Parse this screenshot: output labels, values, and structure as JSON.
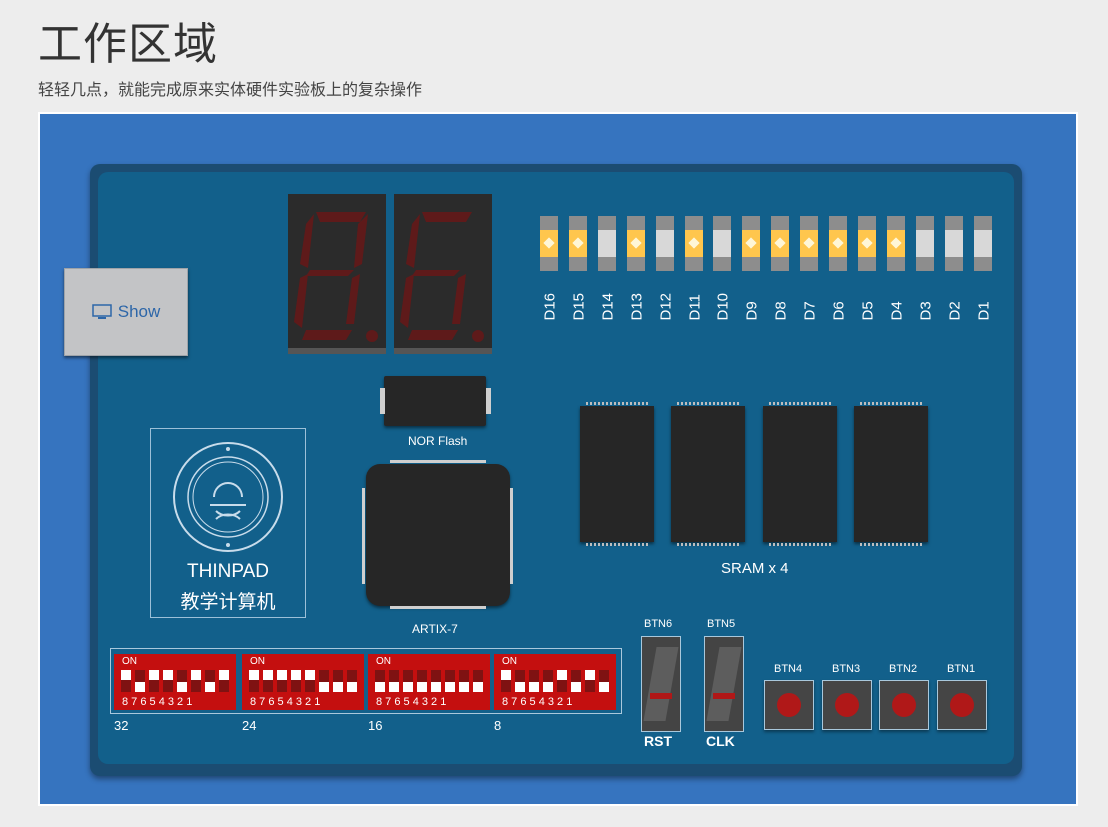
{
  "page": {
    "title": "工作区域",
    "subtitle": "轻轻几点，就能完成原来实体硬件实验板上的复杂操作"
  },
  "show_button": {
    "label": "Show",
    "icon": "monitor-icon"
  },
  "leds": [
    {
      "label": "D16",
      "on": true
    },
    {
      "label": "D15",
      "on": true
    },
    {
      "label": "D14",
      "on": false
    },
    {
      "label": "D13",
      "on": true
    },
    {
      "label": "D12",
      "on": false
    },
    {
      "label": "D11",
      "on": true
    },
    {
      "label": "D10",
      "on": false
    },
    {
      "label": "D9",
      "on": true
    },
    {
      "label": "D8",
      "on": true
    },
    {
      "label": "D7",
      "on": true
    },
    {
      "label": "D6",
      "on": true
    },
    {
      "label": "D5",
      "on": true
    },
    {
      "label": "D4",
      "on": true
    },
    {
      "label": "D3",
      "on": false
    },
    {
      "label": "D2",
      "on": false
    },
    {
      "label": "D1",
      "on": false
    }
  ],
  "chips": {
    "flash": "NOR Flash",
    "fpga": "ARTIX-7",
    "sram": "SRAM x 4"
  },
  "logo": {
    "name": "THINPAD",
    "subtitle": "教学计算机"
  },
  "dip_switches": [
    {
      "group": "32",
      "on_label": "ON",
      "numbers": "8 7 6 5 4 3 2 1",
      "states": [
        "up",
        "dn",
        "up",
        "up",
        "dn",
        "up",
        "dn",
        "up"
      ]
    },
    {
      "group": "24",
      "on_label": "ON",
      "numbers": "8 7 6 5 4 3 2 1",
      "states": [
        "up",
        "up",
        "up",
        "up",
        "up",
        "dn",
        "dn",
        "dn"
      ]
    },
    {
      "group": "16",
      "on_label": "ON",
      "numbers": "8 7 6 5 4 3 2 1",
      "states": [
        "dn",
        "dn",
        "dn",
        "dn",
        "dn",
        "dn",
        "dn",
        "dn"
      ]
    },
    {
      "group": "8",
      "on_label": "ON",
      "numbers": "8 7 6 5 4 3 2 1",
      "states": [
        "up",
        "dn",
        "dn",
        "dn",
        "up",
        "dn",
        "up",
        "dn"
      ]
    }
  ],
  "toggles": [
    {
      "button": "BTN6",
      "name": "RST"
    },
    {
      "button": "BTN5",
      "name": "CLK"
    }
  ],
  "push_buttons": [
    "BTN4",
    "BTN3",
    "BTN2",
    "BTN1"
  ],
  "colors": {
    "workspace": "#3674bf",
    "board": "#12608b",
    "led_on": "#ffc64d",
    "switch_red": "#c40f0f"
  }
}
